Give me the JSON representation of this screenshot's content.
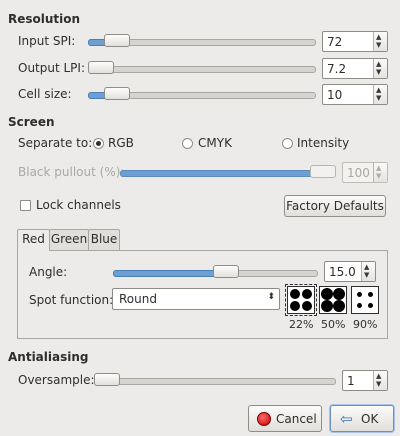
{
  "resolution": {
    "title": "Resolution",
    "input_spi": {
      "label": "Input SPI:",
      "value": "72",
      "slider_fraction": 0.08
    },
    "output_lpi": {
      "label": "Output LPI:",
      "value": "7.2",
      "slider_fraction": 0.0
    },
    "cell_size": {
      "label": "Cell size:",
      "value": "10",
      "slider_fraction": 0.08
    }
  },
  "screen": {
    "title": "Screen",
    "separate_to_label": "Separate to:",
    "options": [
      {
        "label": "RGB",
        "selected": true
      },
      {
        "label": "CMYK",
        "selected": false
      },
      {
        "label": "Intensity",
        "selected": false
      }
    ],
    "black_pullout": {
      "label": "Black pullout (%):",
      "value": "100",
      "slider_fraction": 1.0
    },
    "lock_channels_label": "Lock channels",
    "factory_defaults_label": "Factory Defaults"
  },
  "tabs": [
    {
      "label": "Red",
      "active": true
    },
    {
      "label": "Green",
      "active": false
    },
    {
      "label": "Blue",
      "active": false
    }
  ],
  "channel": {
    "angle": {
      "label": "Angle:",
      "value": "15.0",
      "slider_fraction": 0.56
    },
    "spot_function": {
      "label": "Spot function:",
      "value": "Round"
    },
    "previews": [
      "22%",
      "50%",
      "90%"
    ]
  },
  "antialiasing": {
    "title": "Antialiasing",
    "oversample": {
      "label": "Oversample:",
      "value": "1",
      "slider_fraction": 0.0
    }
  },
  "buttons": {
    "cancel": "Cancel",
    "ok": "OK"
  }
}
